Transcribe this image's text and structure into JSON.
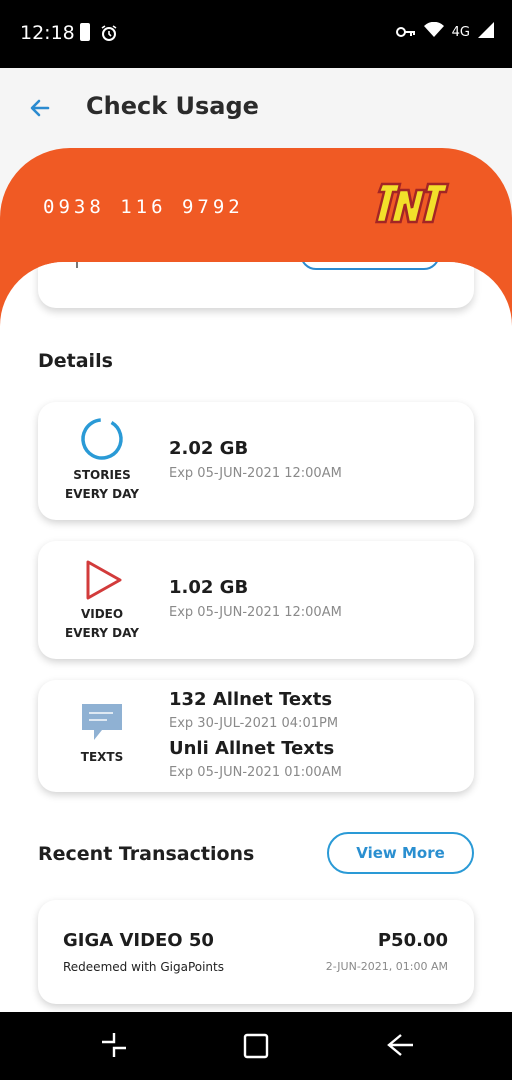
{
  "status_bar": {
    "time": "12:18",
    "network": "4G"
  },
  "app_bar": {
    "title": "Check Usage",
    "back_icon": "arrow-left-icon"
  },
  "account": {
    "number": "0938 116 9792",
    "brand_logo": "TNT",
    "accent_color": "#f05a24"
  },
  "details": {
    "title": "Details",
    "items": [
      {
        "icon": "stories-ring-icon",
        "label_line1": "STORIES",
        "label_line2": "EVERY DAY",
        "amount": "2.02 GB",
        "expiry": "Exp 05-JUN-2021 12:00AM"
      },
      {
        "icon": "video-play-icon",
        "label_line1": "VIDEO",
        "label_line2": "EVERY DAY",
        "amount": "1.02 GB",
        "expiry": "Exp 05-JUN-2021 12:00AM"
      },
      {
        "icon": "message-bubble-icon",
        "label": "TEXTS",
        "amount_1": "132 Allnet Texts",
        "expiry_1": "Exp 30-JUL-2021 04:01PM",
        "amount_2": "Unli Allnet Texts",
        "expiry_2": "Exp 05-JUN-2021 01:00AM"
      }
    ]
  },
  "transactions": {
    "title": "Recent Transactions",
    "view_more_label": "View More",
    "items": [
      {
        "name": "GIGA VIDEO 50",
        "subtitle": "Redeemed with GigaPoints",
        "amount": "P50.00",
        "date": "2-JUN-2021, 01:00 AM"
      }
    ]
  }
}
